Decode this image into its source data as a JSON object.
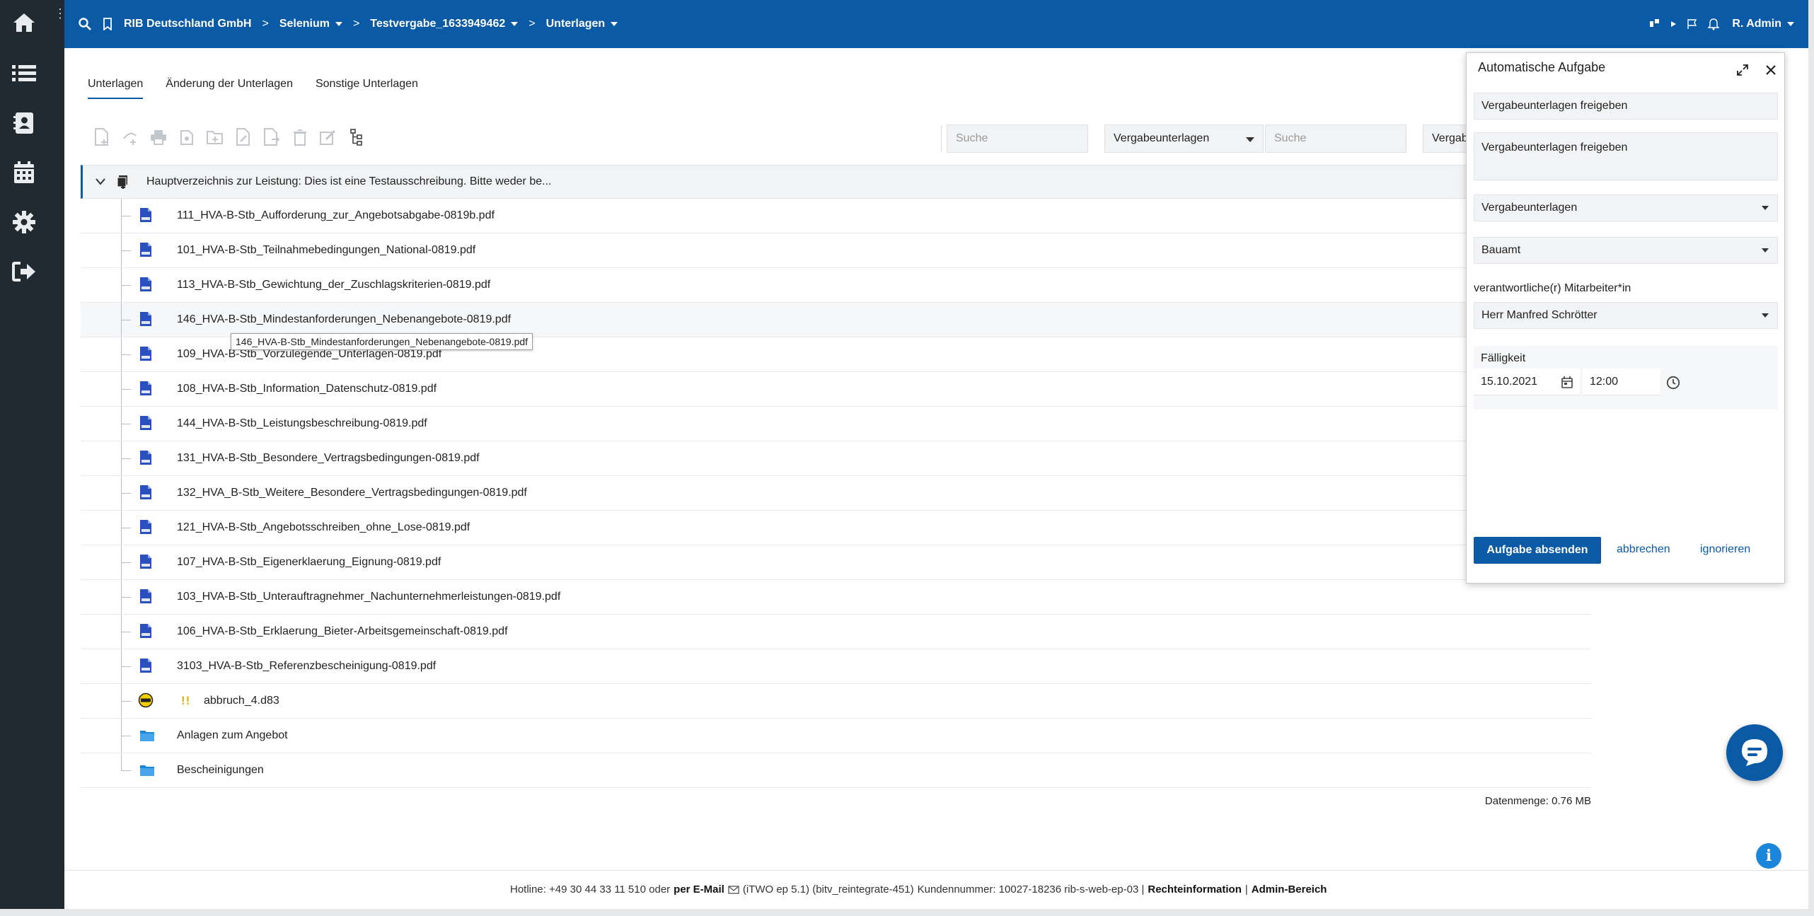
{
  "sidebar": {
    "items": [
      {
        "name": "home-icon"
      },
      {
        "name": "list-icon"
      },
      {
        "name": "contacts-icon"
      },
      {
        "name": "calendar-icon"
      },
      {
        "name": "gear-icon"
      },
      {
        "name": "logout-icon"
      }
    ],
    "kebab": "⋮"
  },
  "topbar": {
    "company": "RIB Deutschland GmbH",
    "crumbs": [
      "Selenium",
      "Testvergabe_1633949462",
      "Unterlagen"
    ],
    "user": "R. Admin",
    "separator": ">"
  },
  "tabs": [
    "Unterlagen",
    "Änderung der Unterlagen",
    "Sonstige Unterlagen"
  ],
  "filters": {
    "search_placeholder": "Suche",
    "category_select": "Vergabeunterlagen",
    "search2_placeholder": "Suche",
    "third_select": "Vergab"
  },
  "tree": {
    "root_label": "Hauptverzeichnis zur Leistung: Dies ist eine Testausschreibung. Bitte weder be...",
    "rows": [
      {
        "label": "111_HVA-B-Stb_Aufforderung_zur_Angebotsabgabe-0819b.pdf",
        "type": "pdf"
      },
      {
        "label": "101_HVA-B-Stb_Teilnahmebedingungen_National-0819.pdf",
        "type": "pdf"
      },
      {
        "label": "113_HVA-B-Stb_Gewichtung_der_Zuschlagskriterien-0819.pdf",
        "type": "pdf"
      },
      {
        "label": "146_HVA-B-Stb_Mindestanforderungen_Nebenangebote-0819.pdf",
        "type": "pdf"
      },
      {
        "label": "109_HVA-B-Stb_Vorzulegende_Unterlagen-0819.pdf",
        "type": "pdf"
      },
      {
        "label": "108_HVA-B-Stb_Information_Datenschutz-0819.pdf",
        "type": "pdf"
      },
      {
        "label": "144_HVA-B-Stb_Leistungsbeschreibung-0819.pdf",
        "type": "pdf"
      },
      {
        "label": "131_HVA-B-Stb_Besondere_Vertragsbedingungen-0819.pdf",
        "type": "pdf"
      },
      {
        "label": "132_HVA_B-Stb_Weitere_Besondere_Vertragsbedingungen-0819.pdf",
        "type": "pdf"
      },
      {
        "label": "121_HVA-B-Stb_Angebotsschreiben_ohne_Lose-0819.pdf",
        "type": "pdf"
      },
      {
        "label": "107_HVA-B-Stb_Eigenerklaerung_Eignung-0819.pdf",
        "type": "pdf"
      },
      {
        "label": "103_HVA-B-Stb_Unterauftragnehmer_Nachunternehmerleistungen-0819.pdf",
        "type": "pdf"
      },
      {
        "label": "106_HVA-B-Stb_Erklaerung_Bieter-Arbeitsgemeinschaft-0819.pdf",
        "type": "pdf"
      },
      {
        "label": "3103_HVA-B-Stb_Referenzbescheinigung-0819.pdf",
        "type": "pdf"
      },
      {
        "label": "abbruch_4.d83",
        "type": "gaeb",
        "warning": "!!"
      },
      {
        "label": "Anlagen zum Angebot",
        "type": "folder"
      },
      {
        "label": "Bescheinigungen",
        "type": "folder"
      }
    ],
    "tooltip": "146_HVA-B-Stb_Mindestanforderungen_Nebenangebote-0819.pdf",
    "datasize": "Datenmenge: 0.76 MB"
  },
  "dialog": {
    "title": "Automatische Aufgabe",
    "subject": "Vergabeunterlagen freigeben",
    "description": "Vergabeunterlagen freigeben",
    "category": "Vergabeunterlagen",
    "department": "Bauamt",
    "responsible_label": "verantwortliche(r) Mitarbeiter*in",
    "responsible": "Herr Manfred Schrötter",
    "due_label": "Fälligkeit",
    "due_date": "15.10.2021",
    "due_time": "12:00",
    "submit_label": "Aufgabe absenden",
    "cancel_label": "abbrechen",
    "ignore_label": "ignorieren"
  },
  "footer": {
    "hotline": "Hotline: +49 30 44 33 11 510 oder",
    "email_link": "per E-Mail",
    "version": "(iTWO ep 5.1) (bitv_reintegrate-451)",
    "customer": "Kundennummer: 10027-18236 rib-s-web-ep-03 |",
    "legal_link": "Rechteinformation",
    "pipe": "|",
    "admin_link": "Admin-Bereich"
  },
  "colors": {
    "brand_blue": "#0a5aa6",
    "sidebar_dark": "#212a31",
    "pdf_blue": "#2a4fbf",
    "folder_blue": "#1a86d9",
    "warning_yellow": "#e4b300"
  }
}
